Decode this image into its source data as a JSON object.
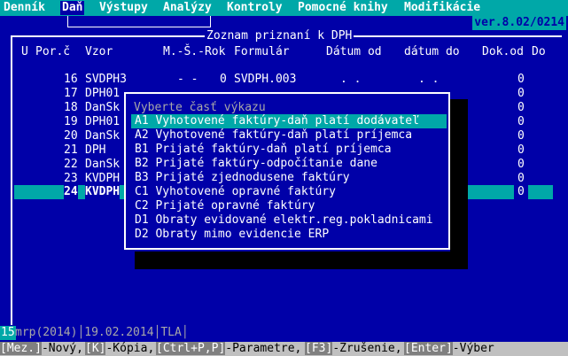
{
  "menu": [
    {
      "label": "Denník",
      "active": false
    },
    {
      "label": "Daň",
      "active": true
    },
    {
      "label": "Výstupy",
      "active": false
    },
    {
      "label": "Analýzy",
      "active": false
    },
    {
      "label": "Kontroly",
      "active": false
    },
    {
      "label": "Pomocné knihy",
      "active": false
    },
    {
      "label": "Modifikácie",
      "active": false
    }
  ],
  "version": "ver.8.02/0214",
  "list": {
    "title": "Zoznam priznaní k DPH",
    "headers": {
      "u": "U",
      "por": "Por.č",
      "vzor": "Vzor",
      "ms": "M.-Š.-Rok",
      "formular": "Formulár",
      "datum_od": "Dátum od",
      "datum_do": "dátum do",
      "dok_od": "Dok.od",
      "do": "Do"
    },
    "rows": [
      {
        "por": "16",
        "vzor": "SVDPH3",
        "ms": "- -",
        "rok": "0",
        "formular": "SVDPH.003",
        "datum_od": ".  .",
        "datum_do": ".  .",
        "dok_od": "0"
      },
      {
        "por": "17",
        "vzor": "DPH01",
        "dok_od": "0"
      },
      {
        "por": "18",
        "vzor": "DanSk",
        "dok_od": "0"
      },
      {
        "por": "19",
        "vzor": "DPH01",
        "dok_od": "0"
      },
      {
        "por": "20",
        "vzor": "DanSk",
        "dok_od": "0"
      },
      {
        "por": "21",
        "vzor": "DPH",
        "dok_od": "0"
      },
      {
        "por": "22",
        "vzor": "DanSk",
        "dok_od": "0"
      },
      {
        "por": "23",
        "vzor": "KVDPH",
        "dok_od": "0"
      },
      {
        "por": "24",
        "vzor": "KVDPH",
        "dok_od": "0",
        "selected": true
      }
    ]
  },
  "popup": {
    "title": "Vyberte časť výkazu",
    "options": [
      {
        "label": "A1 Vyhotovené faktúry-daň platí dodávateľ",
        "selected": true
      },
      {
        "label": "A2 Vyhotovené faktúry-daň platí príjemca"
      },
      {
        "label": "B1 Prijaté faktúry-daň platí príjemca"
      },
      {
        "label": "B2 Prijaté faktúry-odpočítanie dane"
      },
      {
        "label": "B3 Prijaté zjednodusene faktúry"
      },
      {
        "label": "C1 Vyhotovené opravné faktúry"
      },
      {
        "label": "C2 Prijaté opravné faktúry"
      },
      {
        "label": "D1 Obraty evidované elektr.reg.pokladnicami"
      },
      {
        "label": "D2 Obraty mimo evidencie ERP"
      }
    ]
  },
  "status": {
    "left": "15",
    "text": "mrp(2014)│19.02.2014│TLA│"
  },
  "keybar": [
    {
      "key": "[Mez.]",
      "label": "-Nový,"
    },
    {
      "key": "[K]",
      "label": "-Kópia,"
    },
    {
      "key": "[Ctrl+P,P]",
      "label": "-Parametre,"
    },
    {
      "key": "[F3]",
      "label": "-Zrušenie,"
    },
    {
      "key": "[Enter]",
      "label": "-Výber"
    }
  ],
  "colors": {
    "background": "#0000a8",
    "accent": "#00a8a8",
    "text": "#ffffff",
    "dim": "#a8a8a8"
  }
}
